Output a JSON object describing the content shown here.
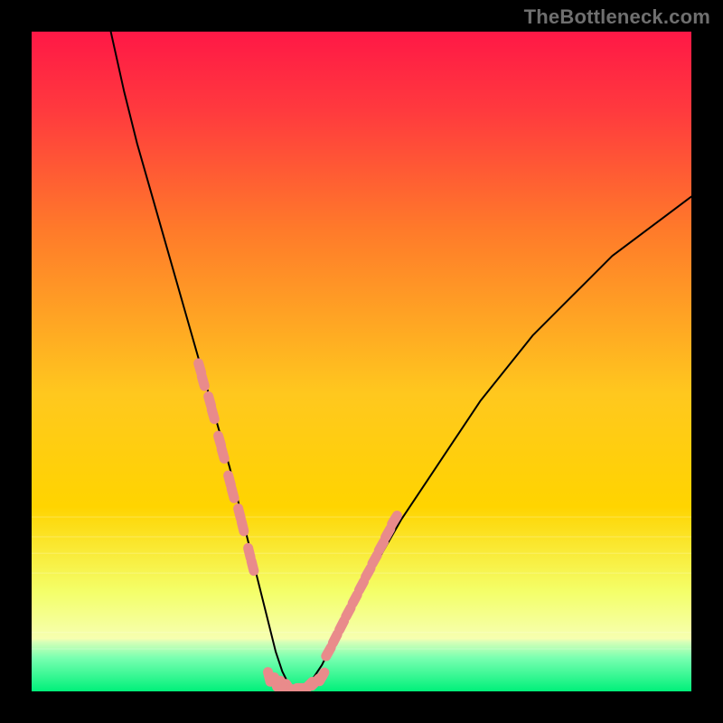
{
  "watermark": "TheBottleneck.com",
  "chart_data": {
    "type": "line",
    "title": "",
    "xlabel": "",
    "ylabel": "",
    "xlim": [
      0,
      100
    ],
    "ylim": [
      0,
      100
    ],
    "grid": false,
    "legend": false,
    "curve": {
      "name": "bottleneck_curve",
      "x": [
        12,
        14,
        16,
        18,
        20,
        22,
        24,
        26,
        28,
        30,
        32,
        33,
        34,
        35,
        36,
        37,
        38,
        39,
        40,
        42,
        44,
        46,
        48,
        52,
        56,
        60,
        64,
        68,
        72,
        76,
        80,
        84,
        88,
        92,
        96,
        100
      ],
      "y": [
        100,
        91,
        83,
        76,
        69,
        62,
        55,
        48,
        41,
        34,
        26,
        22,
        18,
        14,
        10,
        6,
        3,
        1,
        0,
        1,
        4,
        8,
        12,
        19,
        26,
        32,
        38,
        44,
        49,
        54,
        58,
        62,
        66,
        69,
        72,
        75
      ]
    },
    "markers_left": {
      "name": "left_cluster",
      "color": "#e98b8b",
      "x": [
        25.5,
        26.0,
        27.0,
        27.5,
        28.5,
        29.0,
        30.0,
        30.5,
        31.5,
        32.0,
        33.0,
        33.5
      ],
      "y": [
        49,
        47,
        44,
        42,
        38,
        36,
        32,
        30,
        27,
        25,
        21,
        19
      ]
    },
    "markers_right": {
      "name": "right_cluster",
      "color": "#e98b8b",
      "x": [
        45.0,
        46.0,
        47.0,
        48.0,
        49.0,
        50.0,
        51.0,
        52.0,
        53.0,
        54.0,
        55.0
      ],
      "y": [
        6,
        8,
        10,
        12,
        14,
        16,
        18,
        20,
        22,
        24,
        26
      ]
    },
    "markers_bottom": {
      "name": "bottom_cluster",
      "color": "#e98b8b",
      "x": [
        36.0,
        37.0,
        38.0,
        39.0,
        40.0,
        41.0,
        42.0,
        43.0,
        44.0
      ],
      "y": [
        2.2,
        1.4,
        0.9,
        0.5,
        0.3,
        0.5,
        0.9,
        1.4,
        2.2
      ]
    },
    "background_gradient": {
      "top": "#ff1846",
      "mid": "#ffd400",
      "bottom_band_top": "#f6ffb0",
      "bottom_band_low": "#00f07a"
    }
  }
}
